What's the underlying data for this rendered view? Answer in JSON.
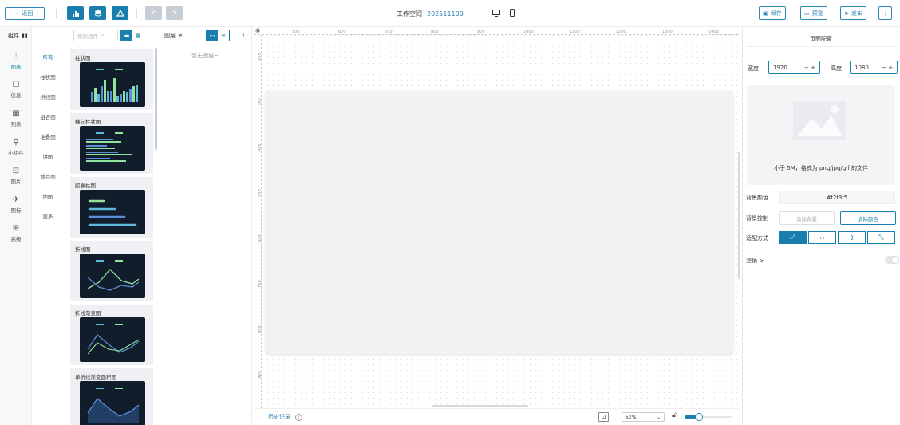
{
  "toolbar": {
    "back_label": "返回",
    "workspace_label": "工作空间",
    "workspace_id": "202511100",
    "save_label": "保存",
    "preview_label": "预览",
    "publish_label": "发布",
    "more_label": "⋮"
  },
  "components": {
    "header": "组件",
    "search_placeholder": "搜索组件",
    "nav": [
      {
        "label": "图表",
        "icon": "chart-icon",
        "active": true
      },
      {
        "label": "信息",
        "icon": "info-icon",
        "active": false
      },
      {
        "label": "列表",
        "icon": "table-icon",
        "active": false
      },
      {
        "label": "小组件",
        "icon": "widget-icon",
        "active": false
      },
      {
        "label": "图片",
        "icon": "image-icon",
        "active": false
      },
      {
        "label": "图标",
        "icon": "plane-icon",
        "active": false
      },
      {
        "label": "高级",
        "icon": "advanced-icon",
        "active": false
      }
    ],
    "subnav": [
      "所有",
      "柱状图",
      "折线图",
      "组合图",
      "堆叠图",
      "饼图",
      "散点图",
      "地图",
      "更多"
    ],
    "cards": [
      "柱状图",
      "横向柱状图",
      "胶囊柱图",
      "折线图",
      "折线渐变图",
      "单折线渐变面积图"
    ]
  },
  "layers": {
    "header": "图层",
    "empty_text": "暂无图层~"
  },
  "canvas": {
    "ruler_top": [
      "500",
      "600",
      "700",
      "800",
      "900",
      "1000",
      "1100",
      "1200",
      "1300",
      "1400"
    ],
    "ruler_left": [
      "200",
      "300",
      "400",
      "500",
      "600",
      "700",
      "800",
      "900"
    ],
    "history_label": "历史记录",
    "zoom": "52%"
  },
  "page_config": {
    "title": "页面配置",
    "width_label": "宽度",
    "width_value": "1920",
    "height_label": "高度",
    "height_value": "1080",
    "upload_note": "小于 5M，格式为 png/jpg/gif 的文件",
    "bg_color_label": "背景颜色",
    "bg_color_value": "#f2f3f5",
    "bg_control_label": "背景控制",
    "clear_bg_label": "清除背景",
    "clear_color_label": "清除颜色",
    "fit_label": "适配方式",
    "filter_label": "滤镜 >"
  },
  "colors": {
    "accent": "#1a7fae",
    "chart_bg": "#121d2c",
    "bar_green": "#8fe39a",
    "bar_blue": "#5b8ed6",
    "bar_cyan": "#5fb8d8"
  }
}
